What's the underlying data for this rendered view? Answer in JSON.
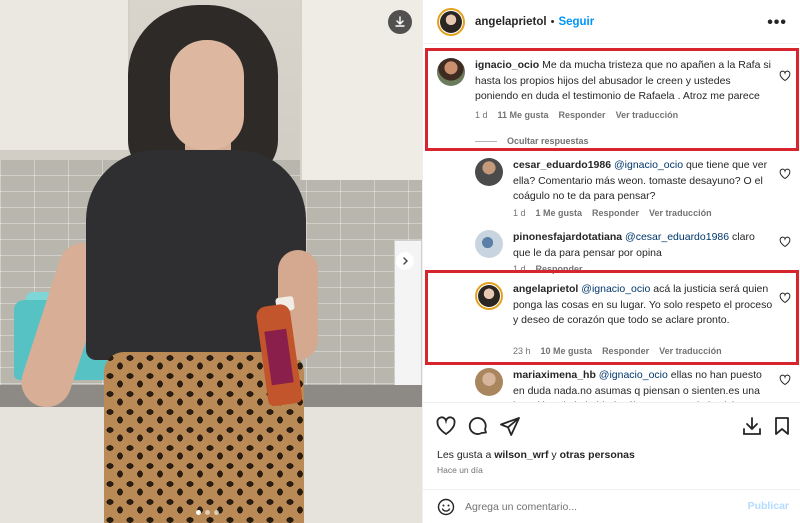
{
  "post": {
    "username": "angelaprietol",
    "separator": "•",
    "follow_label": "Seguir",
    "more_label": "•••"
  },
  "comments": [
    {
      "username": "ignacio_ocio",
      "text": "Me da mucha tristeza que no apañen a la Rafa si hasta los propios hijos del abusador le creen y ustedes poniendo en duda el testimonio de Rafaela . Atroz me parece",
      "age": "1 d",
      "likes": "11 Me gusta",
      "reply": "Responder",
      "translate": "Ver traducción",
      "hide_replies": "Ocultar respuestas",
      "highlighted": true
    },
    {
      "username": "cesar_eduardo1986",
      "mention": "@ignacio_ocio",
      "text": "que tiene que ver ella? Comentario más weon. tomaste desayuno? O el coágulo no te da para pensar?",
      "age": "1 d",
      "likes": "1 Me gusta",
      "reply": "Responder",
      "translate": "Ver traducción"
    },
    {
      "username": "pinonesfajardotatiana",
      "mention": "@cesar_eduardo1986",
      "text": "claro que le da para pensar por opina",
      "age": "1 d",
      "reply": "Responder"
    },
    {
      "username": "angelaprietol",
      "mention": "@ignacio_ocio",
      "text": "acá la justicia será quien ponga las cosas en su lugar. Yo solo respeto el proceso y deseo de corazón que todo se aclare pronto.",
      "age": "23 h",
      "likes": "10 Me gusta",
      "reply": "Responder",
      "translate": "Ver traducción",
      "highlighted": true
    },
    {
      "username": "mariaximena_hb",
      "mention": "@ignacio_ocio",
      "text": "ellas no han puesto en duda nada.no asumas q piensan o sienten.es una invasión a la intimidad .sólo q respetan la justicia o es"
    }
  ],
  "footer": {
    "likes_prefix": "Les gusta a",
    "likes_user": "wilson_wrf",
    "likes_conj": "y",
    "likes_others": "otras personas",
    "time_ago": "Hace un día",
    "comment_placeholder": "Agrega un comentario...",
    "post_label": "Publicar"
  },
  "colors": {
    "highlight_box": "#d7252e",
    "link": "#0095f6",
    "mention": "#00376b",
    "muted": "#737373"
  },
  "icons": [
    "download-icon",
    "chevron-right-icon",
    "more-icon",
    "heart-icon",
    "comment-icon",
    "share-icon",
    "save-icon",
    "emoji-icon"
  ]
}
